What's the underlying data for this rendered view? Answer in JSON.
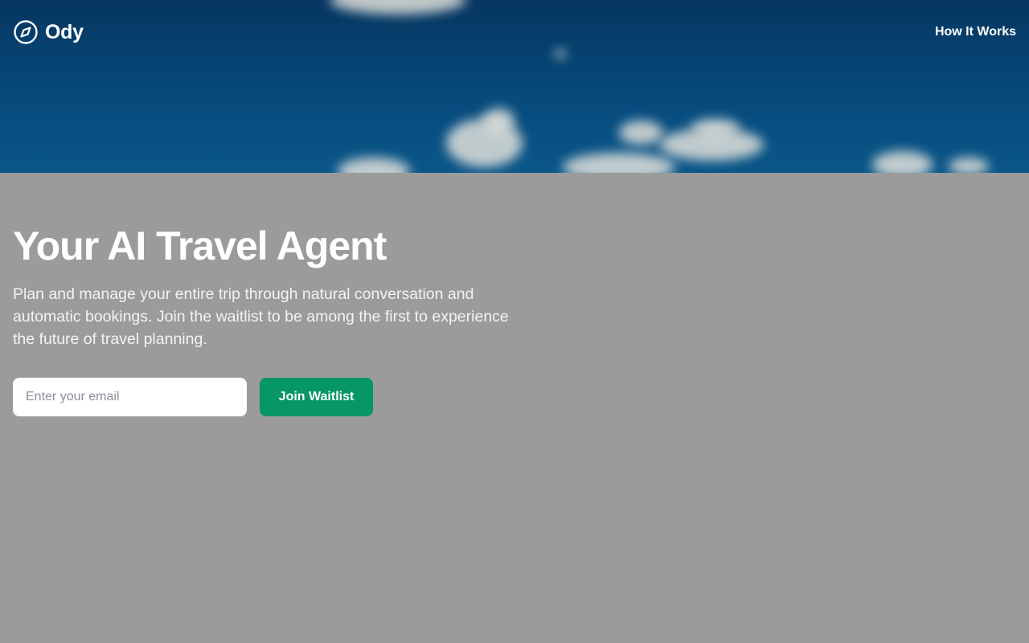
{
  "brand": {
    "name": "Ody",
    "icon": "compass-icon",
    "color": "#ffffff"
  },
  "nav": {
    "how_it_works": "How It Works"
  },
  "hero": {
    "title": "Your AI Travel Agent",
    "subtitle": "Plan and manage your entire trip through natural conversation and automatic bookings. Join the waitlist to be among the first to experience the future of travel planning."
  },
  "signup": {
    "email_placeholder": "Enter your email",
    "email_value": "",
    "button_label": "Join Waitlist",
    "button_color": "#069668"
  },
  "colors": {
    "sky": "#074a7c",
    "overlay": "#9b9b9b"
  }
}
